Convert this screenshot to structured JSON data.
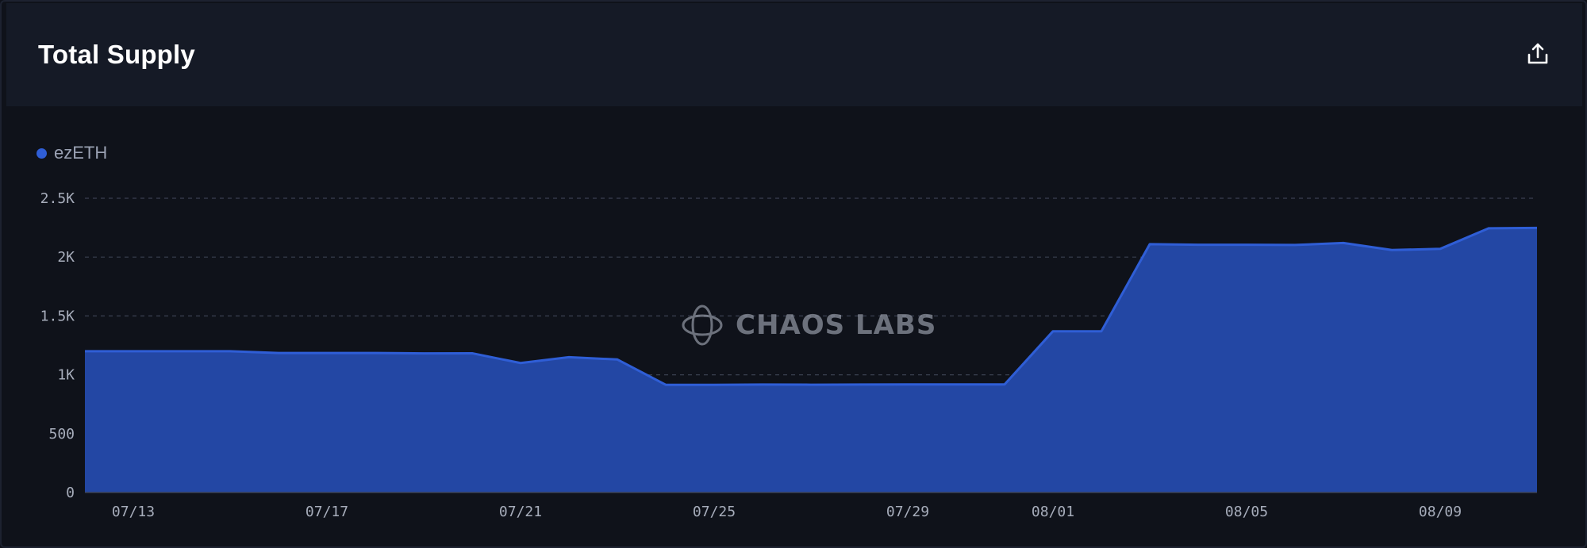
{
  "header": {
    "title": "Total Supply",
    "export_icon": "share-upload-icon"
  },
  "watermark": {
    "text": "CHAOS LABS",
    "icon": "chaos-labs-logo-icon"
  },
  "colors": {
    "series_fill": "#2347a4",
    "series_line": "#2f5ed6",
    "grid": "#3a4050",
    "tick_text": "#a7adbb"
  },
  "chart_data": {
    "type": "area",
    "title": "Total Supply",
    "xlabel": "",
    "ylabel": "",
    "ylim": [
      0,
      2500
    ],
    "yticks": [
      0,
      500,
      1000,
      1500,
      2000,
      2500
    ],
    "ytick_labels": [
      "0",
      "500",
      "1K",
      "1.5K",
      "2K",
      "2.5K"
    ],
    "xticks": [
      "07/13",
      "07/17",
      "07/21",
      "07/25",
      "07/29",
      "08/01",
      "08/05",
      "08/09"
    ],
    "grid": true,
    "legend_position": "top-left",
    "x": [
      "07/12",
      "07/13",
      "07/14",
      "07/15",
      "07/16",
      "07/17",
      "07/18",
      "07/19",
      "07/20",
      "07/21",
      "07/22",
      "07/23",
      "07/24",
      "07/25",
      "07/26",
      "07/27",
      "07/28",
      "07/29",
      "07/30",
      "07/31",
      "08/01",
      "08/02",
      "08/03",
      "08/04",
      "08/05",
      "08/06",
      "08/07",
      "08/08",
      "08/09",
      "08/10",
      "08/11"
    ],
    "series": [
      {
        "name": "ezETH",
        "values": [
          1200,
          1200,
          1200,
          1200,
          1185,
          1185,
          1185,
          1182,
          1183,
          1100,
          1150,
          1130,
          915,
          915,
          917,
          916,
          917,
          918,
          918,
          918,
          1370,
          1370,
          2110,
          2105,
          2105,
          2103,
          2120,
          2060,
          2070,
          2245,
          2248
        ]
      }
    ]
  }
}
